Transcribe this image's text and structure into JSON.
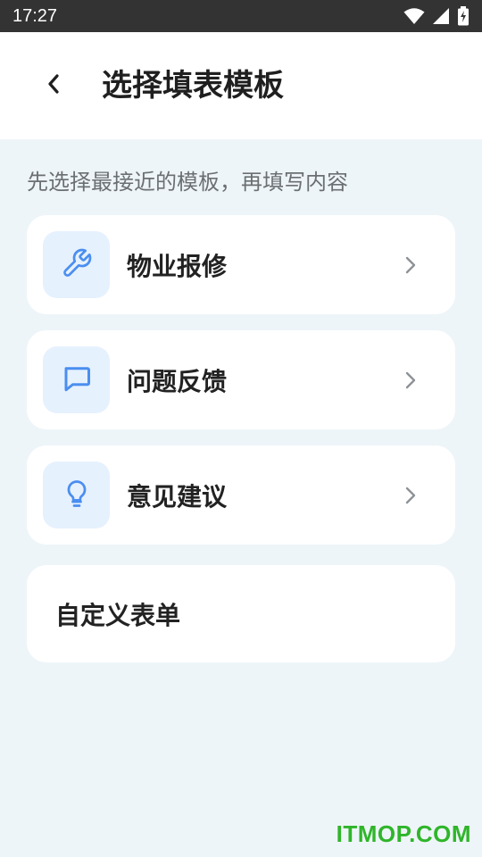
{
  "status_bar": {
    "time": "17:27",
    "icons": [
      "wifi-icon",
      "signal-icon",
      "battery-charging-icon"
    ]
  },
  "header": {
    "back_icon": "chevron-left-icon",
    "title": "选择填表模板"
  },
  "subtitle": "先选择最接近的模板，再填写内容",
  "templates": [
    {
      "label": "物业报修",
      "icon": "wrench-icon"
    },
    {
      "label": "问题反馈",
      "icon": "message-square-icon"
    },
    {
      "label": "意见建议",
      "icon": "lightbulb-icon"
    }
  ],
  "custom_form": {
    "label": "自定义表单"
  },
  "watermark": "ITMOP.COM",
  "colors": {
    "accent": "#4a8ef0",
    "icon_bg": "#e6f1fe",
    "page_bg": "#eef5f8",
    "status_bar": "#333333",
    "watermark": "#2fb52a"
  }
}
